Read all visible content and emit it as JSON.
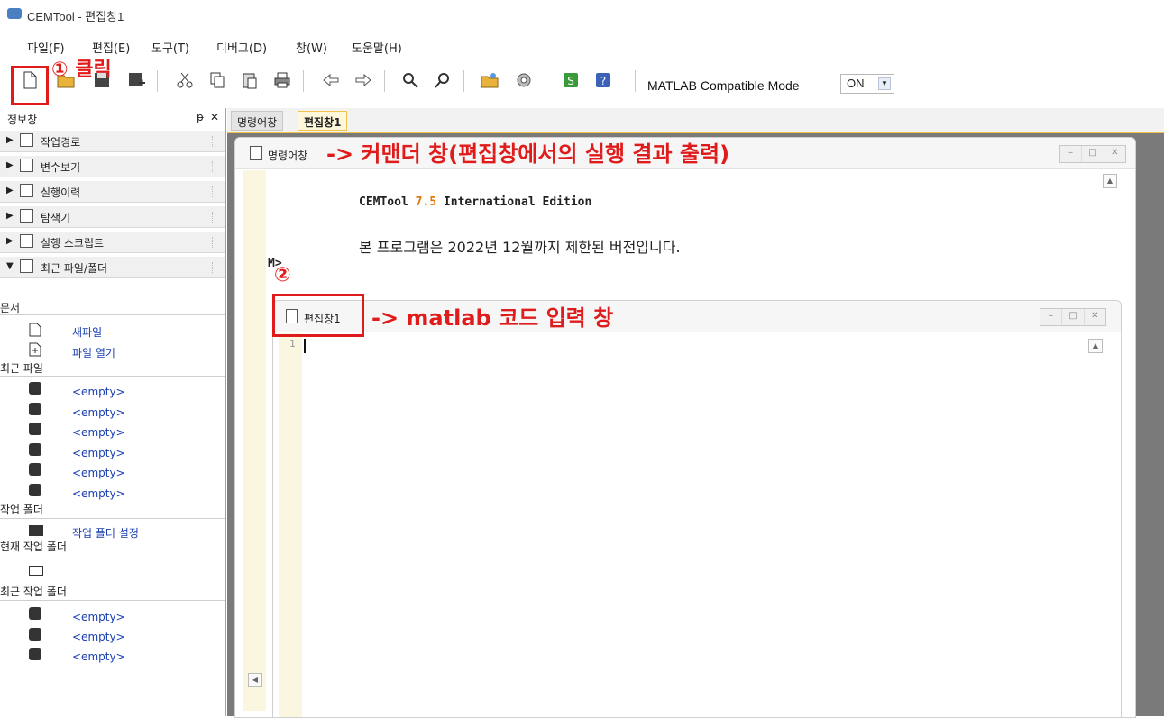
{
  "window": {
    "title": "CEMTool - 편집창1"
  },
  "menu": [
    "파일(F)",
    "편집(E)",
    "도구(T)",
    "디버그(D)",
    "창(W)",
    "도움말(H)"
  ],
  "toolbar": {
    "mode_label": "MATLAB Compatible Mode",
    "mode_value": "ON"
  },
  "info_pane": {
    "title": "정보창",
    "pin": "ᵽ",
    "close": "✕",
    "items": [
      "작업경로",
      "변수보기",
      "실행이력",
      "탐색기",
      "실행 스크립트",
      "최근 파일/폴더"
    ],
    "sections": {
      "doc": "문서",
      "new_file": "새파일",
      "open_file": "파일 열기",
      "recent_files": "최근 파일",
      "empty": "<empty>",
      "work_folder": "작업 폴더",
      "set_work_folder": "작업 폴더 설정",
      "current_folder": "현재 작업 폴더",
      "recent_folders": "최근 작업 폴더"
    }
  },
  "tabs": [
    "명령어창",
    "편집창1"
  ],
  "command_window": {
    "title": "명령어창",
    "banner_prefix": "CEMTool",
    "banner_version": "7.5",
    "banner_suffix": "International Edition",
    "notice": "본 프로그램은 2022년 12월까지 제한된 버전입니다.",
    "prompt": "M>"
  },
  "editor_window": {
    "title": "편집창1",
    "line_number": "1"
  },
  "annotations": {
    "step1": "① 클릭",
    "step2": "②",
    "cmd_desc": "-> 커맨더 창(편집창에서의 실행 결과 출력)",
    "edit_desc": "-> matlab 코드 입력 창"
  },
  "colors": {
    "annotation": "#e01b1b",
    "version": "#e07a10",
    "link": "#1a3fb0"
  }
}
